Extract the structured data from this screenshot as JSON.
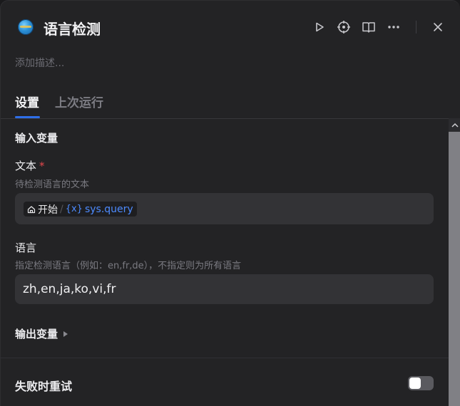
{
  "header": {
    "title": "语言检测",
    "app_icon": "globe-icon",
    "actions": [
      "play-icon",
      "locate-icon",
      "book-icon",
      "more-icon",
      "close-icon"
    ]
  },
  "description_placeholder": "添加描述...",
  "tabs": [
    {
      "label": "设置",
      "active": true
    },
    {
      "label": "上次运行",
      "active": false
    }
  ],
  "input_section": {
    "title": "输入变量",
    "text_field": {
      "label": "文本",
      "required_mark": "*",
      "hint": "待检测语言的文本",
      "var_source": "开始",
      "var_separator": "/",
      "var_symbol": "{x}",
      "var_name": "sys.query"
    },
    "language_field": {
      "label": "语言",
      "hint": "指定检测语言（例如：en,fr,de），不指定则为所有语言",
      "value": "zh,en,ja,ko,vi,fr"
    }
  },
  "output_section": {
    "title": "输出变量"
  },
  "retry": {
    "label": "失败时重试",
    "enabled": false
  },
  "colors": {
    "accent": "#2e6ee8",
    "variable": "#4d8bff",
    "required": "#e5484d",
    "background": "#232325"
  }
}
